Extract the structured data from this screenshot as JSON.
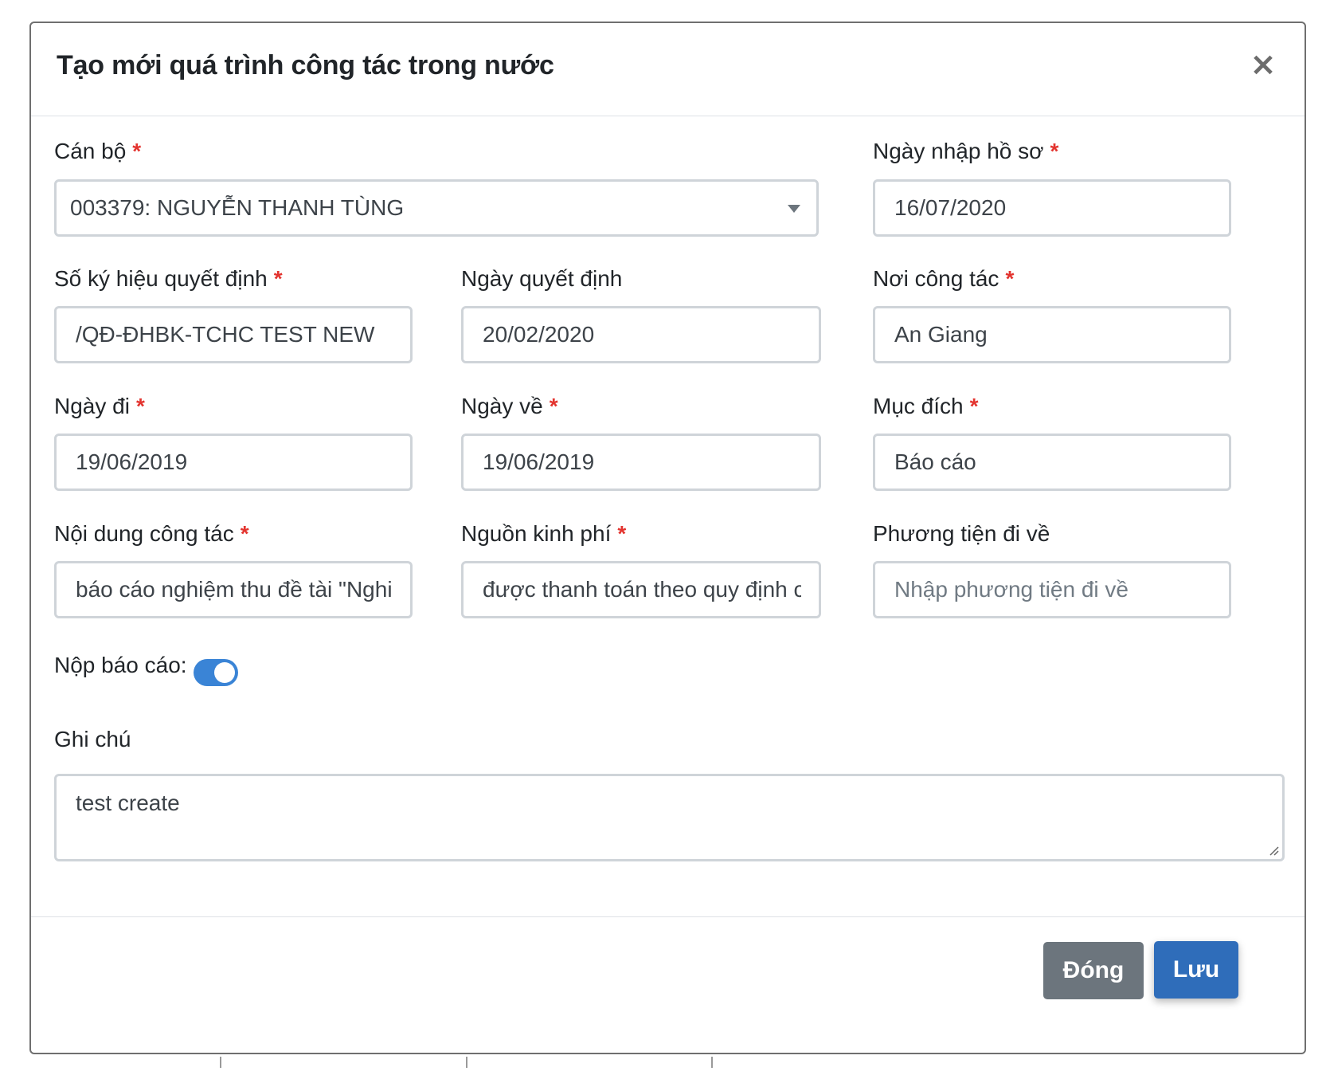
{
  "modal": {
    "title": "Tạo mới quá trình công tác trong nước",
    "close_symbol": "×"
  },
  "required_mark": "*",
  "fields": {
    "can_bo": {
      "label": "Cán bộ",
      "value": "003379: NGUYỄN THANH TÙNG"
    },
    "ngay_nhap_ho_so": {
      "label": "Ngày nhập hồ sơ",
      "value": "16/07/2020"
    },
    "so_ky_hieu": {
      "label": "Số ký hiệu quyết định",
      "value": "/QĐ-ĐHBK-TCHC TEST NEW"
    },
    "ngay_quyet_dinh": {
      "label": "Ngày quyết định",
      "value": "20/02/2020"
    },
    "noi_cong_tac": {
      "label": "Nơi công tác",
      "value": "An Giang"
    },
    "ngay_di": {
      "label": "Ngày đi",
      "value": "19/06/2019"
    },
    "ngay_ve": {
      "label": "Ngày về",
      "value": "19/06/2019"
    },
    "muc_dich": {
      "label": "Mục đích",
      "value": "Báo cáo"
    },
    "noi_dung": {
      "label": "Nội dung công tác",
      "value": "báo cáo nghiệm thu đề tài \"Nghi"
    },
    "nguon_kinh_phi": {
      "label": "Nguồn kinh phí",
      "value": "được thanh toán theo quy định c"
    },
    "phuong_tien": {
      "label": "Phương tiện đi về",
      "value": "",
      "placeholder": "Nhập phương tiện đi về"
    },
    "nop_bao_cao": {
      "label": "Nộp báo cáo:",
      "checked": true
    },
    "ghi_chu": {
      "label": "Ghi chú",
      "value": "test create"
    }
  },
  "footer": {
    "close_label": "Đóng",
    "save_label": "Lưu"
  },
  "colors": {
    "required": "#e3342f",
    "toggle_on": "#3a84d6",
    "btn_secondary": "#6c757d",
    "btn_primary": "#2f6dba",
    "border": "#cfd4d9"
  }
}
